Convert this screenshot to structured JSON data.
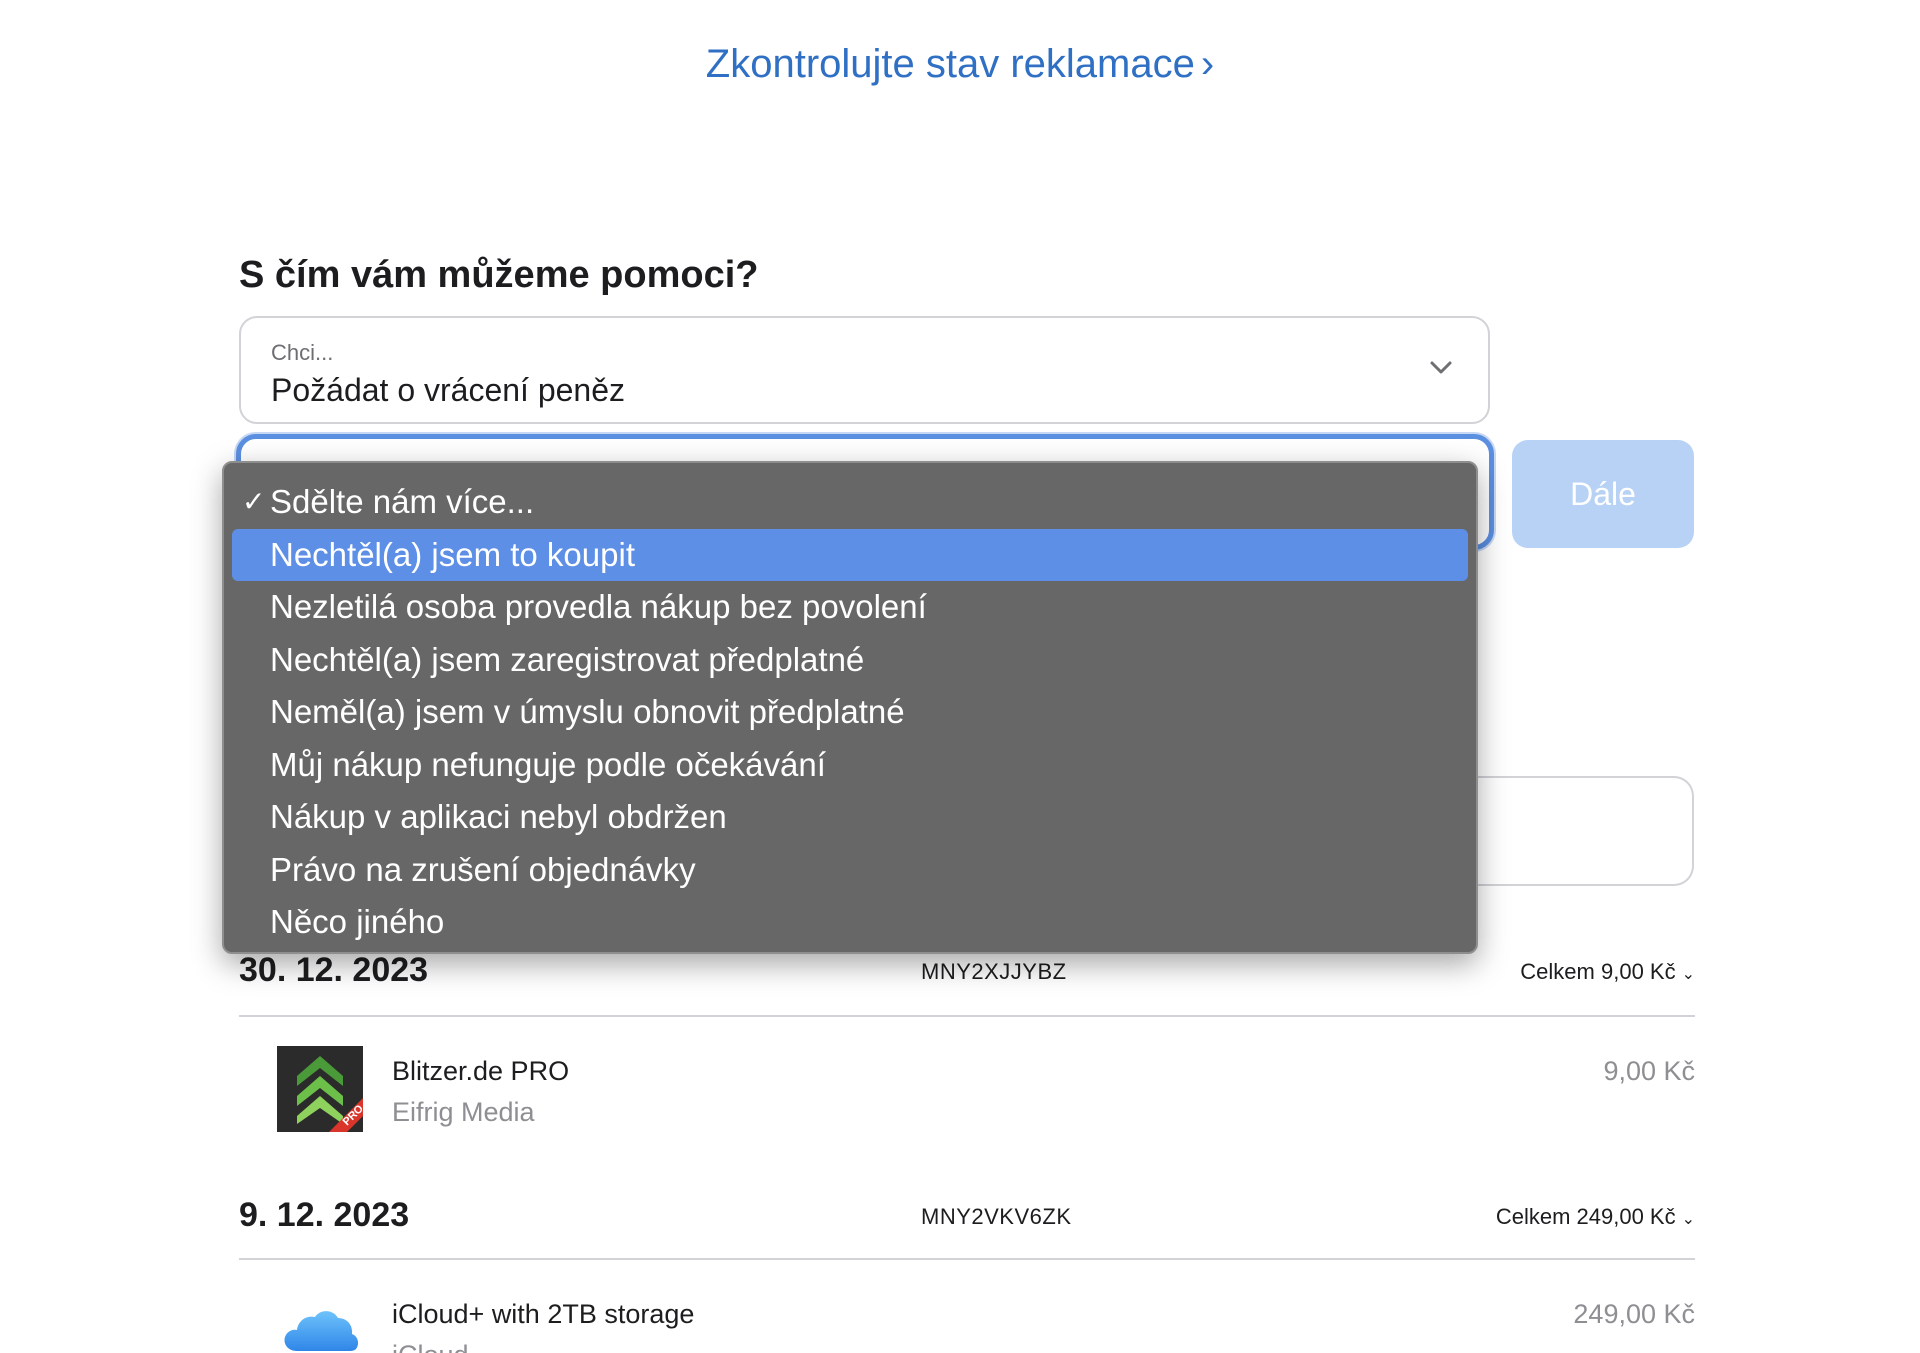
{
  "status_link": {
    "label": "Zkontrolujte stav reklamace",
    "chevron": "›"
  },
  "help_heading": "S čím vám můžeme pomoci?",
  "intent_select": {
    "label": "Chci...",
    "value": "Požádat o vrácení peněz"
  },
  "next_button": {
    "label": "Dále"
  },
  "reason_menu": {
    "items": [
      {
        "label": "Sdělte nám více...",
        "checked": true
      },
      {
        "label": "Nechtěl(a) jsem to koupit",
        "highlighted": true
      },
      {
        "label": "Nezletilá osoba provedla nákup bez povolení"
      },
      {
        "label": "Nechtěl(a) jsem zaregistrovat předplatné"
      },
      {
        "label": "Neměl(a) jsem v úmyslu obnovit předplatné"
      },
      {
        "label": "Můj nákup nefunguje podle očekávání"
      },
      {
        "label": "Nákup v aplikaci nebyl obdržen"
      },
      {
        "label": "Právo na zrušení objednávky"
      },
      {
        "label": "Něco jiného"
      }
    ],
    "check_glyph": "✓"
  },
  "orders": [
    {
      "date": "30. 12. 2023",
      "order_id": "MNY2XJJYBZ",
      "total": "Celkem 9,00 Kč",
      "item": {
        "name": "Blitzer.de PRO",
        "vendor": "Eifrig Media",
        "price": "9,00 Kč",
        "icon": "blitzer-app-icon"
      }
    },
    {
      "date": "9. 12. 2023",
      "order_id": "MNY2VKV6ZK",
      "total": "Celkem 249,00 Kč",
      "item": {
        "name": "iCloud+ with 2TB storage",
        "vendor": "iCloud",
        "price": "249,00 Kč",
        "icon": "icloud-icon"
      }
    }
  ],
  "colors": {
    "link": "#2f6fc4",
    "menu_bg": "#676767",
    "menu_highlight": "#5d8fe6",
    "focus_ring": "#5b8fe0",
    "button_disabled": "#b8d2f5"
  }
}
